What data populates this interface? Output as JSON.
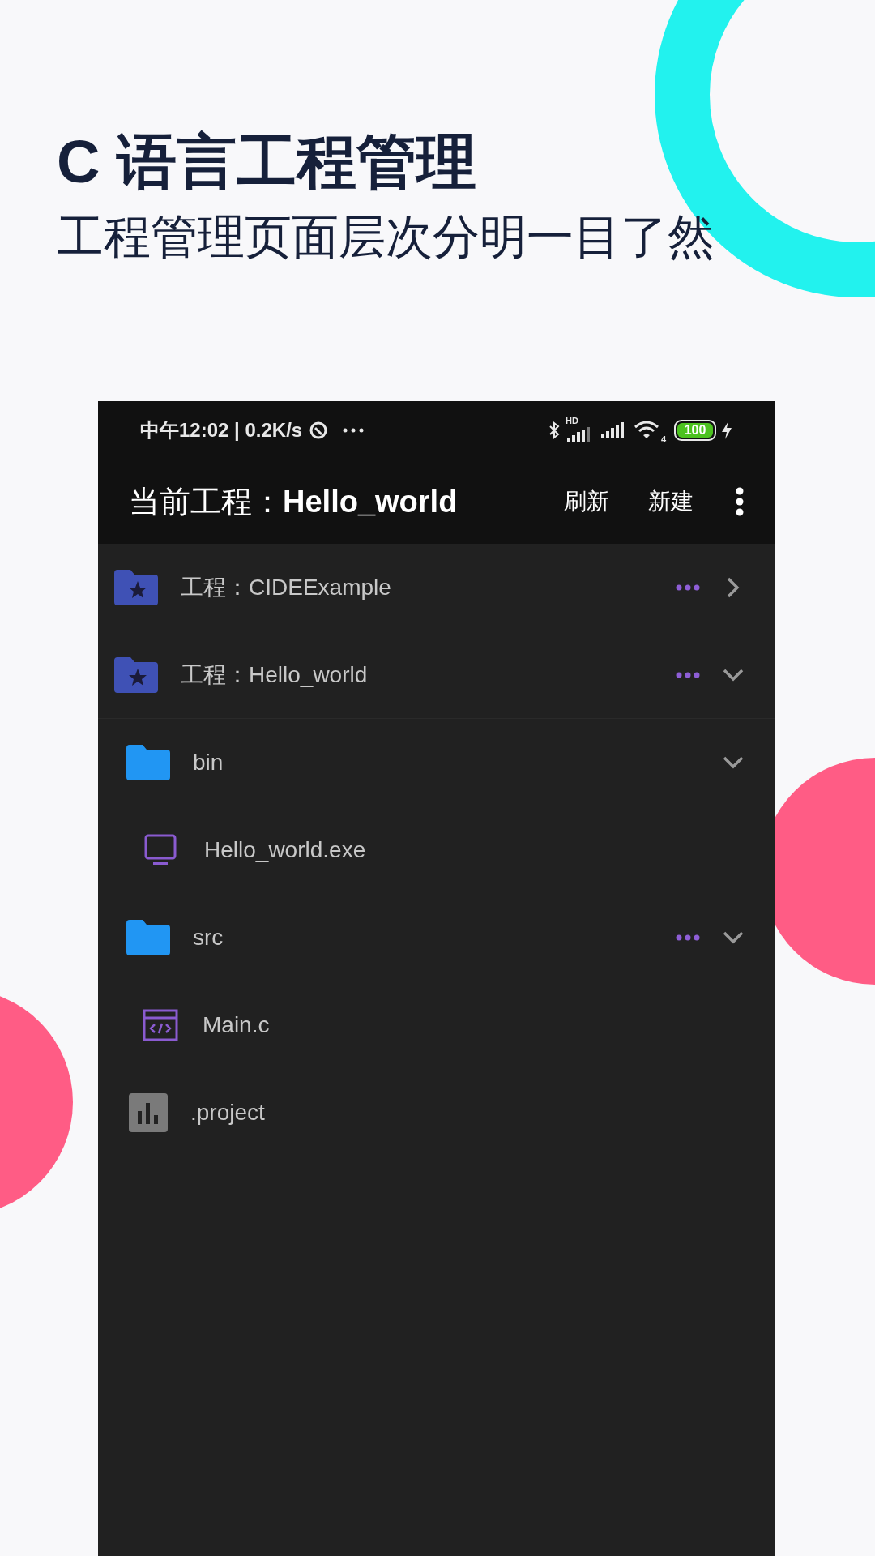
{
  "headline": {
    "title": "C 语言工程管理",
    "subtitle": "工程管理页面层次分明一目了然"
  },
  "status_bar": {
    "time_and_speed": "中午12:02 | 0.2K/s",
    "hd_label": "HD",
    "wifi_label": "4",
    "battery": "100"
  },
  "toolbar": {
    "title": "当前工程：**Hello_world**",
    "actions": [
      "刷新",
      "新建"
    ]
  },
  "tree": [
    {
      "kind": "project",
      "label": "工程：CIDEExample",
      "has_menu": true,
      "expanded": false
    },
    {
      "kind": "project",
      "label": "工程：Hello_world",
      "has_menu": true,
      "expanded": true,
      "children": [
        {
          "kind": "folder",
          "label": "bin",
          "has_menu": false,
          "expanded": true,
          "children": [
            {
              "kind": "executable",
              "label": "Hello_world.exe"
            }
          ]
        },
        {
          "kind": "folder",
          "label": "src",
          "has_menu": true,
          "expanded": true,
          "children": [
            {
              "kind": "source",
              "label": "Main.c"
            }
          ]
        },
        {
          "kind": "data",
          "label": ".project"
        }
      ]
    }
  ]
}
